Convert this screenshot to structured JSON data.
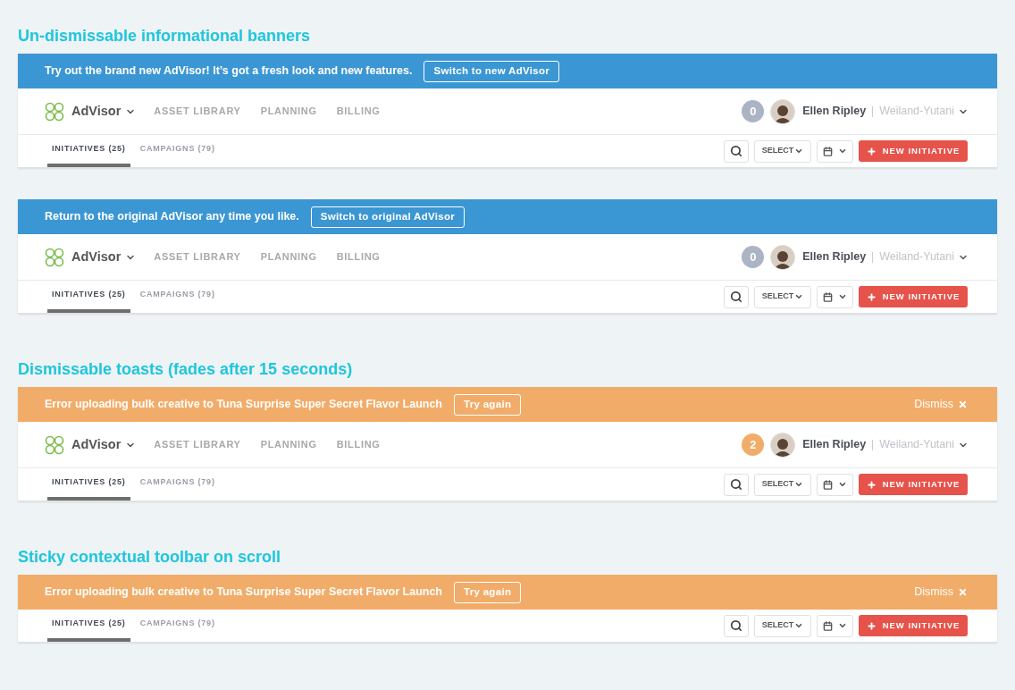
{
  "sections": [
    {
      "heading": "Un-dismissable informational banners",
      "panels": [
        {
          "banner": {
            "kind": "info",
            "message": "Try out the brand new AdVisor! It’s got a fresh look and new features.",
            "action": "Switch to new AdVisor"
          },
          "header": {
            "brand": "AdVisor",
            "nav": [
              "ASSET LIBRARY",
              "PLANNING",
              "BILLING"
            ],
            "notifications": {
              "count": "0",
              "highlighted": false
            },
            "user": "Ellen Ripley",
            "org": "Weiland-Yutani"
          },
          "toolbar": {
            "tabs": [
              {
                "label": "INITIATIVES (25)",
                "selected": true
              },
              {
                "label": "CAMPAIGNS (79)",
                "selected": false
              }
            ],
            "select": "SELECT",
            "new_button": "NEW INITIATIVE"
          }
        },
        {
          "banner": {
            "kind": "info",
            "message": "Return to the original AdVisor any time you like.",
            "action": "Switch to original AdVisor"
          },
          "header": {
            "brand": "AdVisor",
            "nav": [
              "ASSET LIBRARY",
              "PLANNING",
              "BILLING"
            ],
            "notifications": {
              "count": "0",
              "highlighted": false
            },
            "user": "Ellen Ripley",
            "org": "Weiland-Yutani"
          },
          "toolbar": {
            "tabs": [
              {
                "label": "INITIATIVES (25)",
                "selected": true
              },
              {
                "label": "CAMPAIGNS (79)",
                "selected": false
              }
            ],
            "select": "SELECT",
            "new_button": "NEW INITIATIVE"
          }
        }
      ]
    },
    {
      "heading": "Dismissable toasts (fades after 15 seconds)",
      "panels": [
        {
          "banner": {
            "kind": "error",
            "message": "Error uploading bulk creative to Tuna Surprise Super Secret Flavor Launch",
            "action": "Try again",
            "dismiss": "Dismiss"
          },
          "header": {
            "brand": "AdVisor",
            "nav": [
              "ASSET LIBRARY",
              "PLANNING",
              "BILLING"
            ],
            "notifications": {
              "count": "2",
              "highlighted": true
            },
            "user": "Ellen Ripley",
            "org": "Weiland-Yutani"
          },
          "toolbar": {
            "tabs": [
              {
                "label": "INITIATIVES (25)",
                "selected": true
              },
              {
                "label": "CAMPAIGNS (79)",
                "selected": false
              }
            ],
            "select": "SELECT",
            "new_button": "NEW INITIATIVE"
          }
        }
      ]
    },
    {
      "heading": "Sticky contextual toolbar on scroll",
      "panels": [
        {
          "banner": {
            "kind": "error",
            "message": "Error uploading bulk creative to Tuna Surprise Super Secret Flavor Launch",
            "action": "Try again",
            "dismiss": "Dismiss"
          },
          "toolbar": {
            "tabs": [
              {
                "label": "INITIATIVES (25)",
                "selected": true
              },
              {
                "label": "CAMPAIGNS (79)",
                "selected": false
              }
            ],
            "select": "SELECT",
            "new_button": "NEW INITIATIVE"
          }
        }
      ]
    }
  ]
}
